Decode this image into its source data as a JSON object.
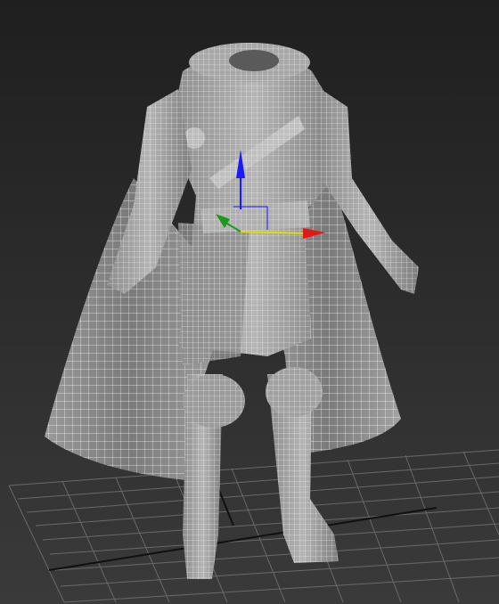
{
  "viewport": {
    "view_label": "",
    "object": "armored-character-model",
    "display_mode": "wireframe-over-shaded",
    "colors": {
      "background_top": "#1f1f1f",
      "background_bottom": "#3a3a3a",
      "grid": "#7a7a7a",
      "grid_axis": "#101010",
      "mesh_fill": "#9a9a9a",
      "wire": "#ffffff",
      "gizmo_x": "#e11818",
      "gizmo_y": "#1a9a1a",
      "gizmo_z": "#1a1aff",
      "gizmo_plane": "#e0e000"
    },
    "gizmo": {
      "axes": [
        "x",
        "y",
        "z"
      ],
      "type": "move-gizmo"
    }
  }
}
